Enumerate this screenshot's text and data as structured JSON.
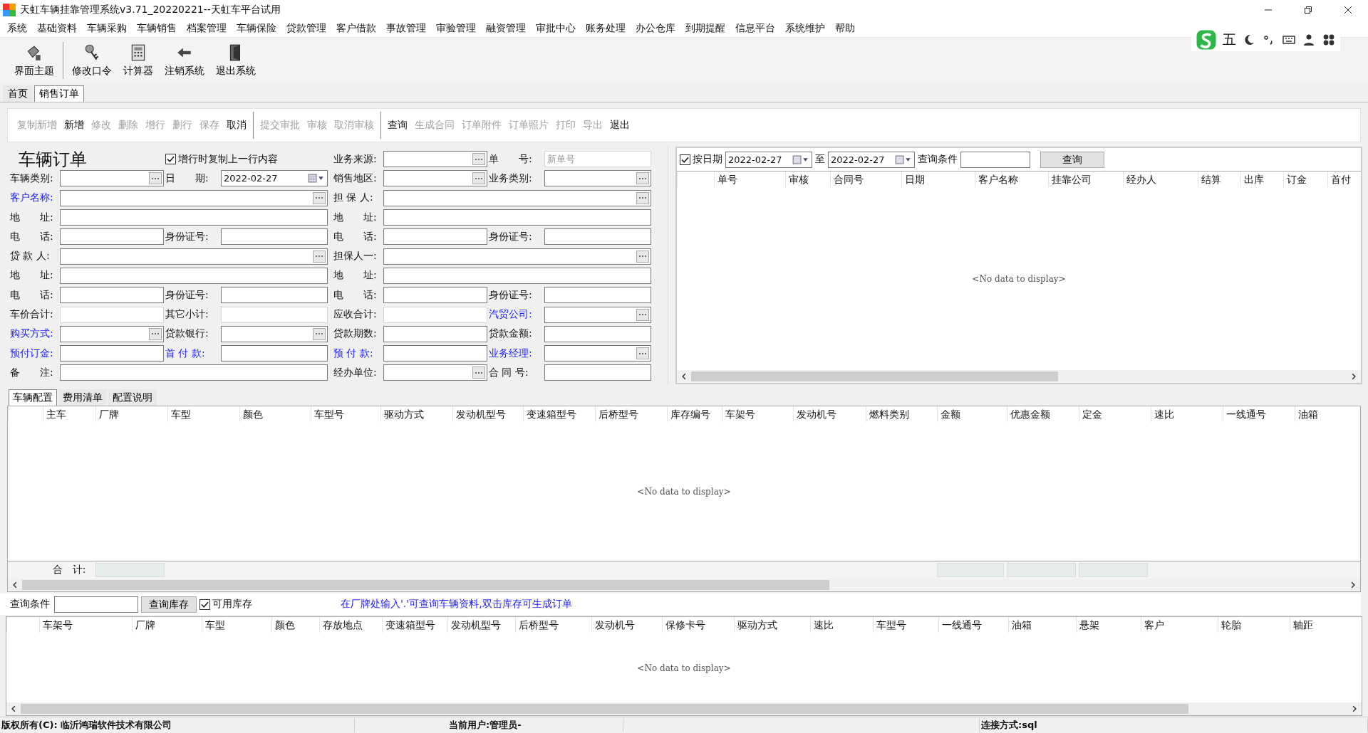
{
  "window": {
    "title": "天虹车辆挂靠管理系统v3.71_20220221--天虹车平台试用"
  },
  "menu": [
    "系统",
    "基础资料",
    "车辆采购",
    "车辆销售",
    "档案管理",
    "车辆保险",
    "贷款管理",
    "客户借款",
    "事故管理",
    "审验管理",
    "融资管理",
    "审批中心",
    "账务处理",
    "办公仓库",
    "到期提醒",
    "信息平台",
    "系统维护",
    "帮助"
  ],
  "ime_bar": {
    "mode": "五"
  },
  "toolbar": [
    "界面主题",
    "修改口令",
    "计算器",
    "注销系统",
    "退出系统"
  ],
  "tabs": [
    {
      "label": "首页",
      "selected": false
    },
    {
      "label": "销售订单",
      "selected": true
    }
  ],
  "actions": [
    [
      {
        "label": "复制新增",
        "disabled": true
      },
      {
        "label": "新增",
        "disabled": false
      },
      {
        "label": "修改",
        "disabled": true
      },
      {
        "label": "删除",
        "disabled": true
      },
      {
        "label": "增行",
        "disabled": true
      },
      {
        "label": "删行",
        "disabled": true
      },
      {
        "label": "保存",
        "disabled": true
      },
      {
        "label": "取消",
        "disabled": false
      }
    ],
    [
      {
        "label": "提交审批",
        "disabled": true
      },
      {
        "label": "审核",
        "disabled": true
      },
      {
        "label": "取消审核",
        "disabled": true
      }
    ],
    [
      {
        "label": "查询",
        "disabled": false
      },
      {
        "label": "生成合同",
        "disabled": true
      },
      {
        "label": "订单附件",
        "disabled": true
      },
      {
        "label": "订单照片",
        "disabled": true
      },
      {
        "label": "打印",
        "disabled": true
      },
      {
        "label": "导出",
        "disabled": true
      },
      {
        "label": "退出",
        "disabled": false
      }
    ]
  ],
  "form": {
    "title": "车辆订单",
    "copy_option": {
      "label": "增行时复制上一行内容",
      "checked": true
    },
    "rows": [
      {
        "left": [],
        "right": [
          {
            "kind": "text",
            "label": "业务来源:",
            "link": false,
            "lookup": true,
            "disabled": false
          },
          {
            "kind": "text",
            "label": "单　　号:",
            "link": false,
            "lookup": false,
            "disabled": true,
            "placeholder": "新单号"
          }
        ]
      },
      {
        "left": [
          {
            "kind": "text",
            "label": "车辆类别:",
            "link": false,
            "lookup": true,
            "disabled": false
          },
          {
            "kind": "date",
            "label": "日　　期:",
            "value": "2022-02-27"
          }
        ],
        "right": [
          {
            "kind": "text",
            "label": "销售地区:",
            "link": false,
            "lookup": true,
            "disabled": false
          },
          {
            "kind": "text",
            "label": "业务类别:",
            "link": false,
            "lookup": true,
            "disabled": false
          }
        ]
      },
      {
        "left": [
          {
            "kind": "text",
            "label": "客户名称:",
            "link": true,
            "lookup": true,
            "disabled": false
          }
        ],
        "right": [
          {
            "kind": "text",
            "label": "担 保 人:",
            "link": false,
            "lookup": true,
            "disabled": false
          }
        ]
      },
      {
        "left": [
          {
            "kind": "text",
            "label": "地　　址:",
            "link": false,
            "lookup": false,
            "disabled": false
          }
        ],
        "right": [
          {
            "kind": "text",
            "label": "地　　址:",
            "link": false,
            "lookup": false,
            "disabled": false
          }
        ]
      },
      {
        "left": [
          {
            "kind": "text",
            "label": "电　　话:",
            "link": false,
            "lookup": false,
            "disabled": false
          },
          {
            "kind": "text",
            "label": "身份证号:",
            "link": false,
            "lookup": false,
            "disabled": false
          }
        ],
        "right": [
          {
            "kind": "text",
            "label": "电　　话:",
            "link": false,
            "lookup": false,
            "disabled": false
          },
          {
            "kind": "text",
            "label": "身份证号:",
            "link": false,
            "lookup": false,
            "disabled": false
          }
        ]
      },
      {
        "left": [
          {
            "kind": "text",
            "label": "贷 款 人:",
            "link": false,
            "lookup": true,
            "disabled": false
          }
        ],
        "right": [
          {
            "kind": "text",
            "label": "担保人一:",
            "link": false,
            "lookup": true,
            "disabled": false
          }
        ]
      },
      {
        "left": [
          {
            "kind": "text",
            "label": "地　　址:",
            "link": false,
            "lookup": false,
            "disabled": false
          }
        ],
        "right": [
          {
            "kind": "text",
            "label": "地　　址:",
            "link": false,
            "lookup": false,
            "disabled": false
          }
        ]
      },
      {
        "left": [
          {
            "kind": "text",
            "label": "电　　话:",
            "link": false,
            "lookup": false,
            "disabled": false
          },
          {
            "kind": "text",
            "label": "身份证号:",
            "link": false,
            "lookup": false,
            "disabled": false
          }
        ],
        "right": [
          {
            "kind": "text",
            "label": "电　　话:",
            "link": false,
            "lookup": false,
            "disabled": false
          },
          {
            "kind": "text",
            "label": "身份证号:",
            "link": false,
            "lookup": false,
            "disabled": false
          }
        ]
      },
      {
        "left": [
          {
            "kind": "text",
            "label": "车价合计:",
            "link": false,
            "lookup": false,
            "disabled": true
          },
          {
            "kind": "text",
            "label": "其它小计:",
            "link": false,
            "lookup": false,
            "disabled": true
          }
        ],
        "right": [
          {
            "kind": "text",
            "label": "应收合计:",
            "link": false,
            "lookup": false,
            "disabled": true
          },
          {
            "kind": "text",
            "label": "汽贸公司:",
            "link": true,
            "lookup": true,
            "disabled": false
          }
        ]
      },
      {
        "left": [
          {
            "kind": "text",
            "label": "购买方式:",
            "link": true,
            "lookup": true,
            "disabled": false
          },
          {
            "kind": "text",
            "label": "贷款银行:",
            "link": false,
            "lookup": true,
            "disabled": false
          }
        ],
        "right": [
          {
            "kind": "text",
            "label": "贷款期数:",
            "link": false,
            "lookup": false,
            "disabled": false
          },
          {
            "kind": "text",
            "label": "贷款金额:",
            "link": false,
            "lookup": false,
            "disabled": false
          }
        ]
      },
      {
        "left": [
          {
            "kind": "text",
            "label": "预付订金:",
            "link": true,
            "lookup": false,
            "disabled": false
          },
          {
            "kind": "text",
            "label": "首 付 款:",
            "link": true,
            "lookup": false,
            "disabled": false
          }
        ],
        "right": [
          {
            "kind": "text",
            "label": "预 付 款:",
            "link": true,
            "lookup": false,
            "disabled": false
          },
          {
            "kind": "text",
            "label": "业务经理:",
            "link": true,
            "lookup": true,
            "disabled": false
          }
        ]
      },
      {
        "left": [
          {
            "kind": "text",
            "label": "备　　注:",
            "link": false,
            "lookup": false,
            "disabled": false
          }
        ],
        "right": [
          {
            "kind": "text",
            "label": "经办单位:",
            "link": false,
            "lookup": true,
            "disabled": false
          },
          {
            "kind": "text",
            "label": "合 同 号:",
            "link": false,
            "lookup": false,
            "disabled": false
          }
        ]
      }
    ]
  },
  "order_list": {
    "by_date": {
      "label": "按日期",
      "checked": true
    },
    "date_from": "2022-02-27",
    "to_label": "至",
    "date_to": "2022-02-27",
    "query_label": "查询条件",
    "query_button": "查询",
    "columns": [
      "单号",
      "审核",
      "合同号",
      "日期",
      "客户名称",
      "挂靠公司",
      "经办人",
      "结算",
      "出库",
      "订金",
      "首付"
    ],
    "empty_text": "<No data to display>"
  },
  "detail_tabs": [
    {
      "label": "车辆配置",
      "selected": true
    },
    {
      "label": "费用清单",
      "selected": false
    },
    {
      "label": "配置说明",
      "selected": false
    }
  ],
  "detail_grid": {
    "columns": [
      "主车",
      "厂牌",
      "车型",
      "颜色",
      "车型号",
      "驱动方式",
      "发动机型号",
      "变速箱型号",
      "后桥型号",
      "库存编号",
      "车架号",
      "发动机号",
      "燃料类别",
      "金额",
      "优惠金额",
      "定金",
      "速比",
      "一线通号",
      "油箱"
    ],
    "empty_text": "<No data to display>",
    "total_label": "合　计:"
  },
  "stock_query": {
    "label": "查询条件",
    "button": "查询库存",
    "available": {
      "label": "可用库存",
      "checked": true
    },
    "hint": "在厂牌处输入'.'可查询车辆资料,双击库存可生成订单"
  },
  "stock_grid": {
    "columns": [
      "车架号",
      "厂牌",
      "车型",
      "颜色",
      "存放地点",
      "变速箱型号",
      "发动机型号",
      "后桥型号",
      "发动机号",
      "保修卡号",
      "驱动方式",
      "速比",
      "车型号",
      "一线通号",
      "油箱",
      "悬架",
      "客户",
      "轮胎",
      "轴距"
    ],
    "empty_text": "<No data to display>"
  },
  "status_bar": {
    "copyright": "版权所有(C): 临沂鸿瑞软件技术有限公司",
    "user": "当前用户:管理员-",
    "connection": "连接方式:sql"
  }
}
